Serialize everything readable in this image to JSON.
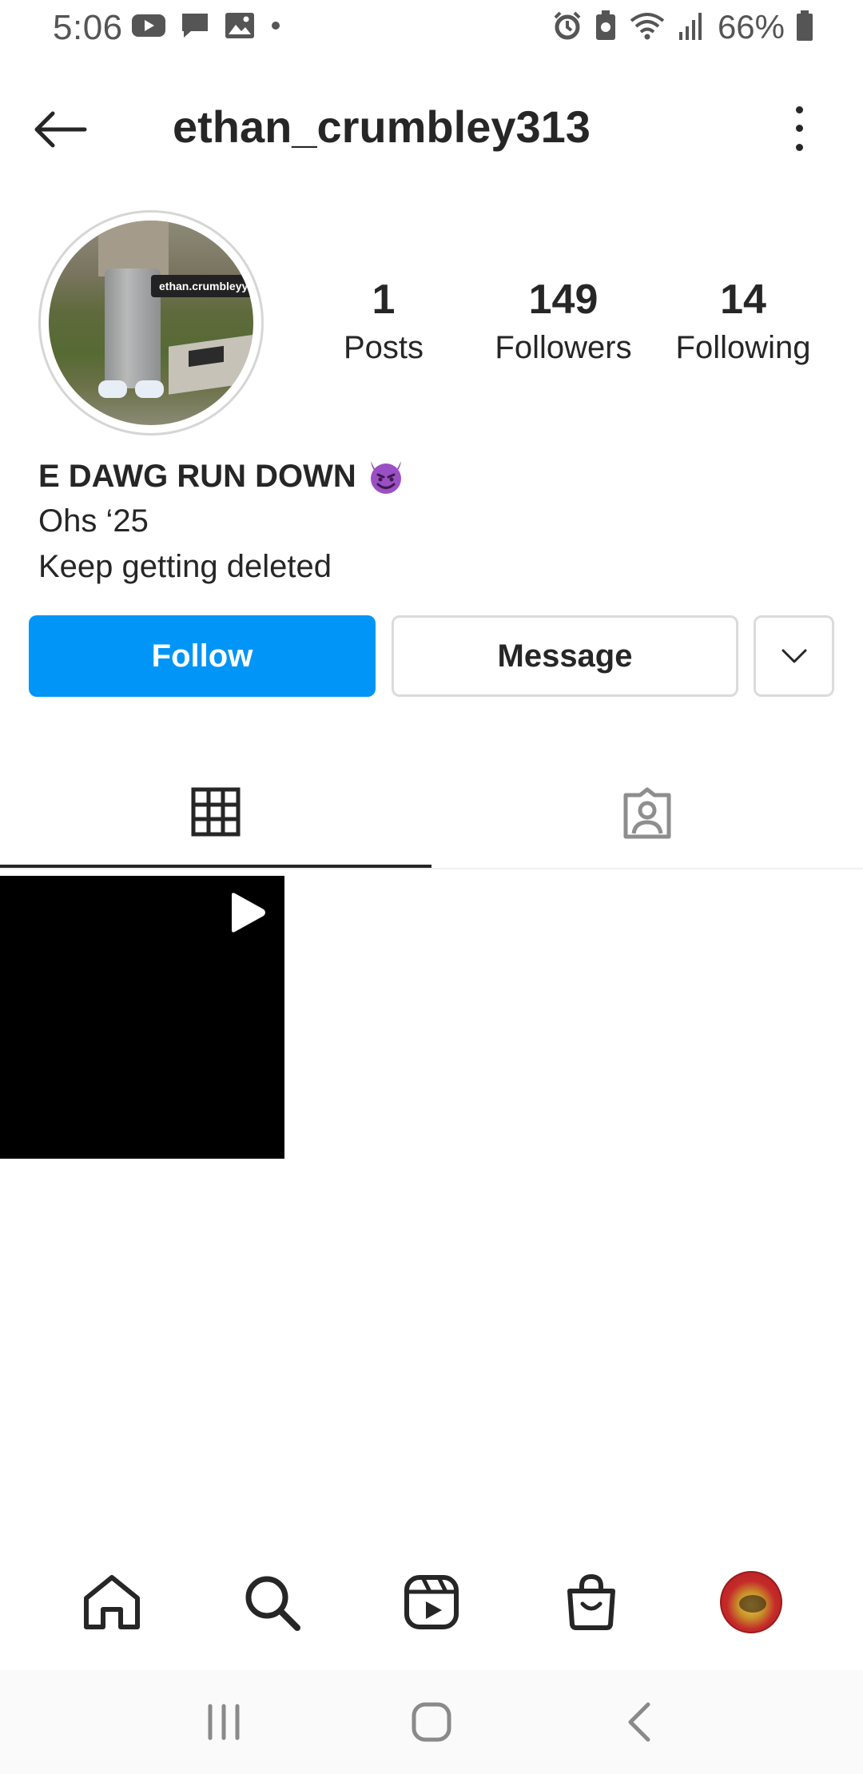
{
  "status_bar": {
    "time": "5:06",
    "battery": "66%",
    "left_icons": [
      "youtube-icon",
      "message-icon",
      "image-icon",
      "dot-icon"
    ],
    "right_icons": [
      "alarm-icon",
      "battery-saver-icon",
      "wifi-icon",
      "signal-icon",
      "battery-icon"
    ]
  },
  "header": {
    "username": "ethan_crumbley313"
  },
  "profile": {
    "avatar_tag": "ethan.crumbleyy",
    "stats": {
      "posts_value": "1",
      "posts_label": "Posts",
      "followers_value": "149",
      "followers_label": "Followers",
      "following_value": "14",
      "following_label": "Following"
    },
    "bio": {
      "name": "E DAWG RUN DOWN",
      "line1": "Ohs ‘25",
      "line2": "Keep getting deleted"
    }
  },
  "actions": {
    "follow_label": "Follow",
    "message_label": "Message"
  },
  "colors": {
    "accent": "#0095f6",
    "text": "#262626",
    "border": "#dbdbdb"
  },
  "tabs": [
    "grid-icon",
    "tagged-icon"
  ],
  "bottom_nav": [
    "home-icon",
    "search-icon",
    "reels-icon",
    "shop-icon",
    "profile-avatar"
  ],
  "system_nav": [
    "recents-icon",
    "home-button-icon",
    "back-icon"
  ]
}
